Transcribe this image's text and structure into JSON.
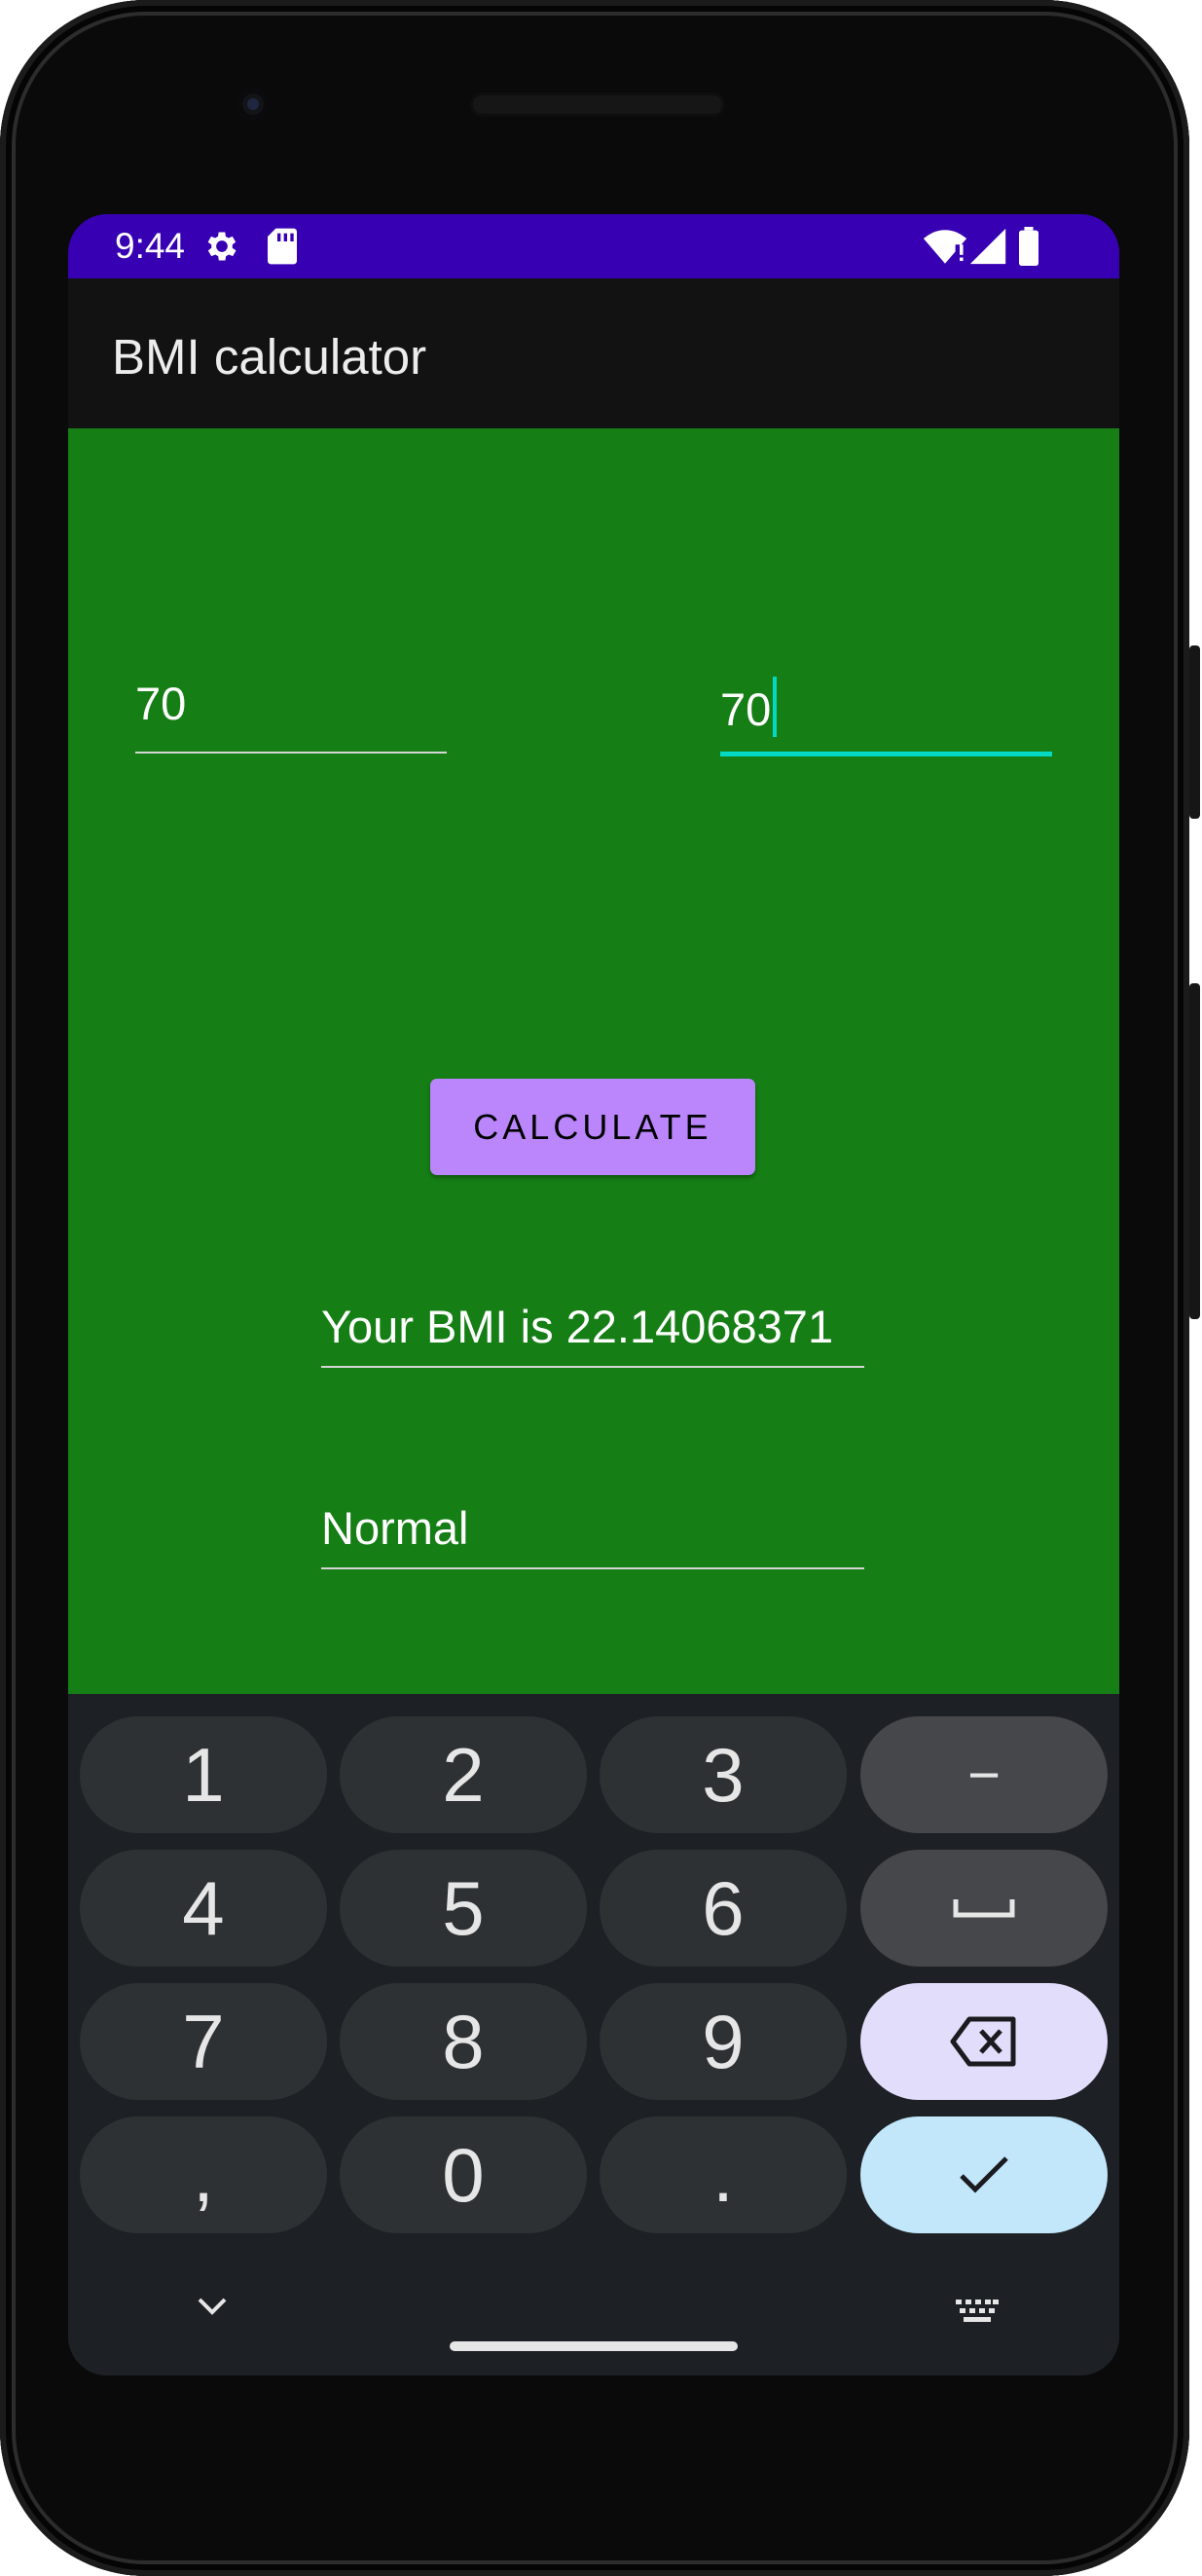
{
  "status_bar": {
    "time": "9:44",
    "icons": [
      "settings-gear-icon",
      "sd-card-icon",
      "wifi-icon",
      "signal-icon",
      "battery-icon"
    ],
    "background": "#3700b3"
  },
  "app_bar": {
    "title": "BMI calculator"
  },
  "form": {
    "height_value": "70",
    "weight_value": "70",
    "calculate_label": "CALCULATE",
    "bmi_result": "Your BMI is 22.14068371",
    "bmi_category": "Normal"
  },
  "colors": {
    "content_background": "#157e15",
    "accent": "#03dac5",
    "button": "#bb86fc"
  },
  "keyboard": {
    "keys": [
      "1",
      "2",
      "3",
      "−",
      "4",
      "5",
      "6",
      "␣",
      "7",
      "8",
      "9",
      "⌫",
      ",",
      "0",
      ".",
      "✓"
    ],
    "nav": [
      "chevron-down-icon",
      "keyboard-icon"
    ]
  }
}
